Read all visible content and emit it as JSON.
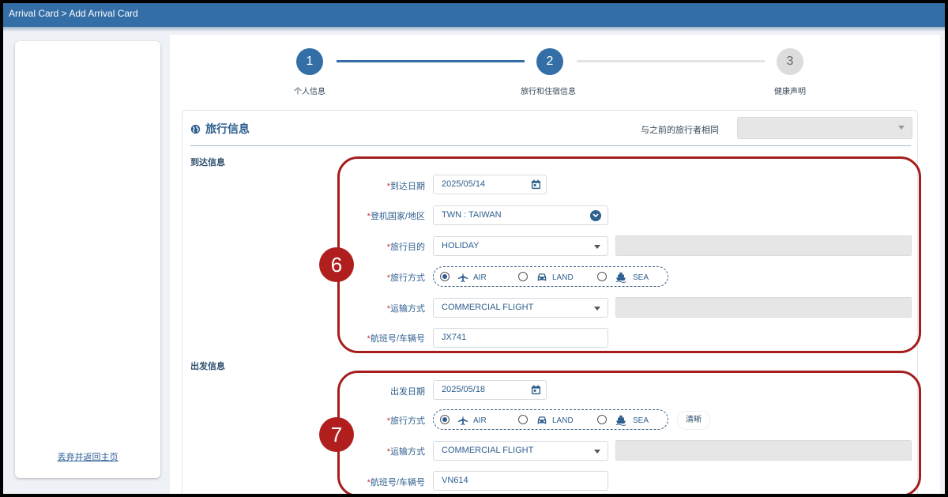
{
  "header": {
    "breadcrumb": "Arrival Card > Add Arrival Card"
  },
  "sidebar": {
    "abandon_link": "丢弃并返回主页"
  },
  "stepper": {
    "steps": [
      {
        "number": "1",
        "label": "个人信息",
        "state": "completed"
      },
      {
        "number": "2",
        "label": "旅行和住宿信息",
        "state": "active"
      },
      {
        "number": "3",
        "label": "健康声明",
        "state": "pending"
      }
    ]
  },
  "travel": {
    "title": "旅行信息",
    "same_as_prev_label": "与之前的旅行者相同",
    "same_as_prev_value": ""
  },
  "arrival": {
    "heading": "到达信息",
    "arrival_date_label": "到达日期",
    "arrival_date": "2025/05/14",
    "boarding_country_label": "登机国家/地区",
    "boarding_country": "TWN : TAIWAN",
    "purpose_label": "旅行目的",
    "purpose": "HOLIDAY",
    "mode_label": "旅行方式",
    "mode_options": [
      "AIR",
      "LAND",
      "SEA"
    ],
    "mode_selected": "AIR",
    "transport_label": "运输方式",
    "transport": "COMMERCIAL FLIGHT",
    "flight_label": "航班号/车辆号",
    "flight": "JX741"
  },
  "departure": {
    "heading": "出发信息",
    "departure_date_label": "出发日期",
    "departure_date": "2025/05/18",
    "mode_label": "旅行方式",
    "mode_options": [
      "AIR",
      "LAND",
      "SEA"
    ],
    "mode_selected": "AIR",
    "clear_label": "清晰",
    "transport_label": "运输方式",
    "transport": "COMMERCIAL FLIGHT",
    "flight_label": "航班号/车辆号",
    "flight": "VN614"
  },
  "annotations": {
    "arrival_badge": "6",
    "departure_badge": "7"
  },
  "colors": {
    "primary": "#336ea6",
    "annotation": "#b01e1e",
    "pending": "#d9d9d9"
  }
}
